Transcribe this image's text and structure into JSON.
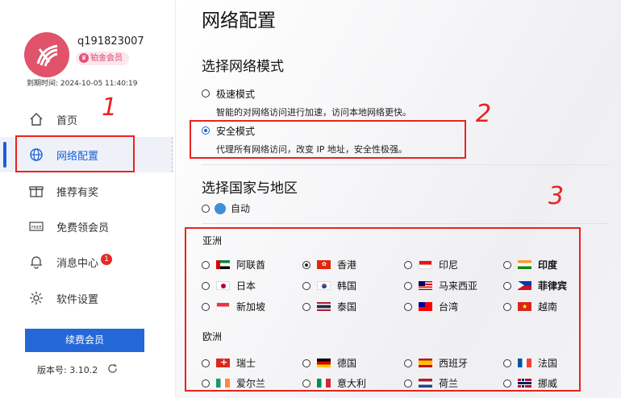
{
  "user": {
    "name": "q191823007",
    "vip_label": "铂金会员",
    "expire_text": "到期时间: 2024-10-05 11:40:19"
  },
  "nav": [
    {
      "label": "首页",
      "icon": "home-icon"
    },
    {
      "label": "网络配置",
      "icon": "globe-icon",
      "active": true
    },
    {
      "label": "推荐有奖",
      "icon": "gift-icon"
    },
    {
      "label": "免费领会员",
      "icon": "free-ticket-icon"
    },
    {
      "label": "消息中心",
      "icon": "bell-icon",
      "badge": "1"
    },
    {
      "label": "软件设置",
      "icon": "gear-icon"
    }
  ],
  "renew_label": "续费会员",
  "version_text": "版本号:  3.10.2",
  "page_title": "网络配置",
  "mode_section": {
    "title": "选择网络模式",
    "fast": {
      "label": "极速模式",
      "desc": "智能的对网络访问进行加速，访问本地网络更快。"
    },
    "secure": {
      "label": "安全模式",
      "desc": "代理所有网络访问，改变 IP 地址，安全性极强。"
    }
  },
  "region_section": {
    "title": "选择国家与地区",
    "auto_label": "自动",
    "asia_title": "亚洲",
    "europe_title": "欧洲",
    "asia": [
      "阿联酋",
      "香港",
      "印尼",
      "印度",
      "日本",
      "韩国",
      "马来西亚",
      "菲律宾",
      "新加坡",
      "泰国",
      "台湾",
      "越南"
    ],
    "europe": [
      "瑞士",
      "德国",
      "西班牙",
      "法国",
      "爱尔兰",
      "意大利",
      "荷兰",
      "挪威"
    ]
  },
  "annotations": [
    "1",
    "2",
    "3"
  ],
  "colors": {
    "accent": "#1a5fd6",
    "annotation": "#e8231f",
    "avatar": "#e0536b"
  }
}
